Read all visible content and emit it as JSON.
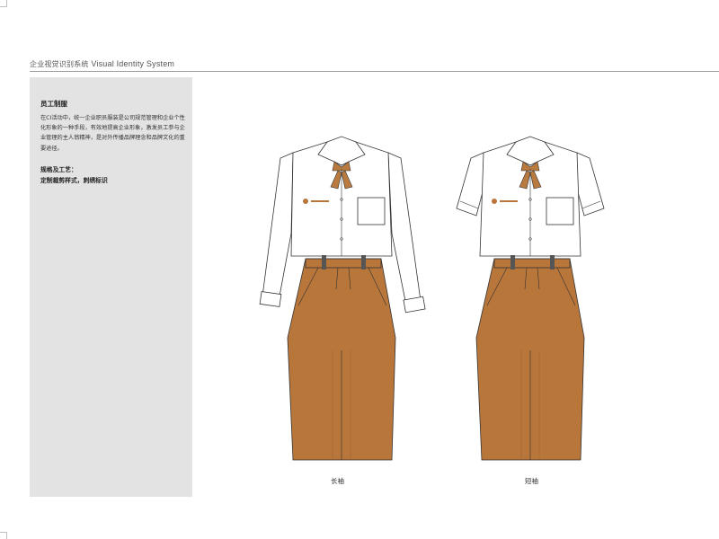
{
  "header": {
    "title_cn": "企业视觉识别系统",
    "title_en": "Visual Identity System"
  },
  "panel": {
    "heading": "员工制服",
    "body": "在CI活动中，统一企业职员服装是公司规范管理和企业个性化形象的一种手段，有效地提高企业形象，激发员工参与企业管理的主人翁精神，是对外传播品牌理念和品牌文化的重要途径。",
    "spec_heading": "规格及工艺：",
    "spec_detail": "定制裁剪样式，刺绣标识"
  },
  "outfits": [
    {
      "caption": "长袖"
    },
    {
      "caption": "短袖"
    }
  ],
  "colors": {
    "skirt": "#B8763B",
    "skirt_shadow": "#9E6230",
    "tie": "#B97A3F",
    "panel_bg": "#E3E3E3",
    "logo": "#B8763B"
  }
}
